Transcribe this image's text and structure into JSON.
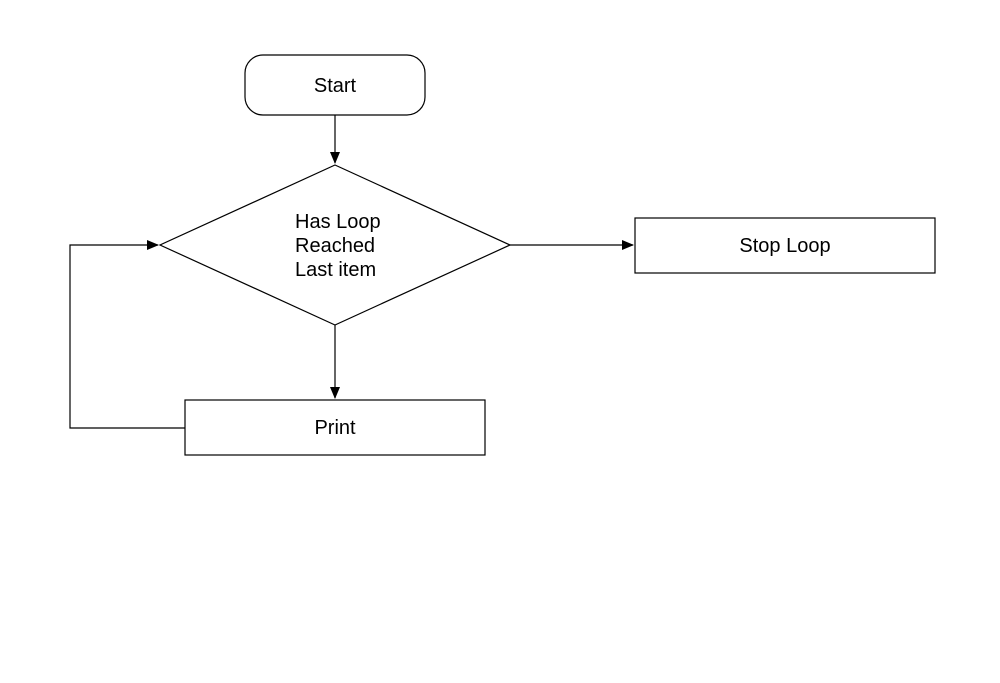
{
  "diagram": {
    "type": "flowchart",
    "nodes": {
      "start": {
        "shape": "terminator",
        "label": "Start"
      },
      "decision": {
        "shape": "decision",
        "line1": "Has Loop",
        "line2": "Reached",
        "line3": "Last item"
      },
      "print": {
        "shape": "process",
        "label": "Print"
      },
      "stop": {
        "shape": "process",
        "label": "Stop Loop"
      }
    },
    "edges": [
      {
        "from": "start",
        "to": "decision",
        "label": ""
      },
      {
        "from": "decision",
        "to": "stop",
        "label": ""
      },
      {
        "from": "decision",
        "to": "print",
        "label": ""
      },
      {
        "from": "print",
        "to": "decision",
        "label": ""
      }
    ]
  }
}
